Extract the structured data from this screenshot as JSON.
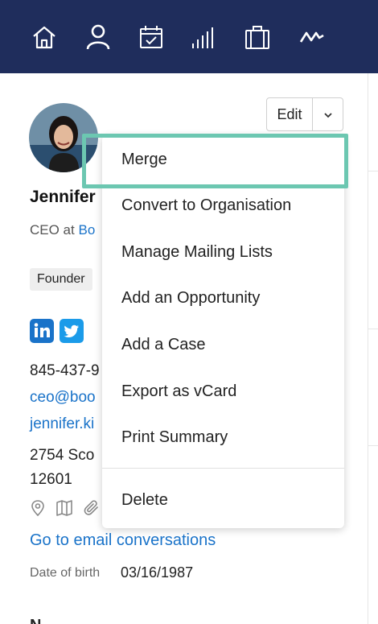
{
  "nav": {
    "icons": [
      "home-icon",
      "person-icon",
      "calendar-icon",
      "signal-bars-icon",
      "briefcase-icon",
      "activity-icon"
    ],
    "background": "#1f2d5c",
    "icon_color": "#ffffff"
  },
  "contact": {
    "name": "Jennifer",
    "role_prefix": "CEO at",
    "organisation": "Bo",
    "tag": "Founder",
    "social": [
      "linkedin",
      "twitter"
    ],
    "phone": "845-437-9",
    "email": "ceo@boo",
    "website": "jennifer.ki",
    "address_line1": "2754 Sco",
    "address_line2": "12601",
    "icons": [
      "location-pin-icon",
      "map-icon",
      "paperclip-icon"
    ],
    "email_conversations_link": "Go to email conversations",
    "dob_label": "Date of birth",
    "dob_value": "03/16/1987",
    "next_section_heading": "N"
  },
  "toolbar": {
    "edit_label": "Edit"
  },
  "menu": {
    "items": [
      "Merge",
      "Convert to Organisation",
      "Manage Mailing Lists",
      "Add an Opportunity",
      "Add a Case",
      "Export as vCard",
      "Print Summary",
      "Delete"
    ],
    "highlighted_item": "Merge"
  },
  "colors": {
    "link": "#1a73c9",
    "highlight_border": "#6cc7b1",
    "linkedin": "#1a73c9",
    "twitter": "#1b9be9"
  }
}
